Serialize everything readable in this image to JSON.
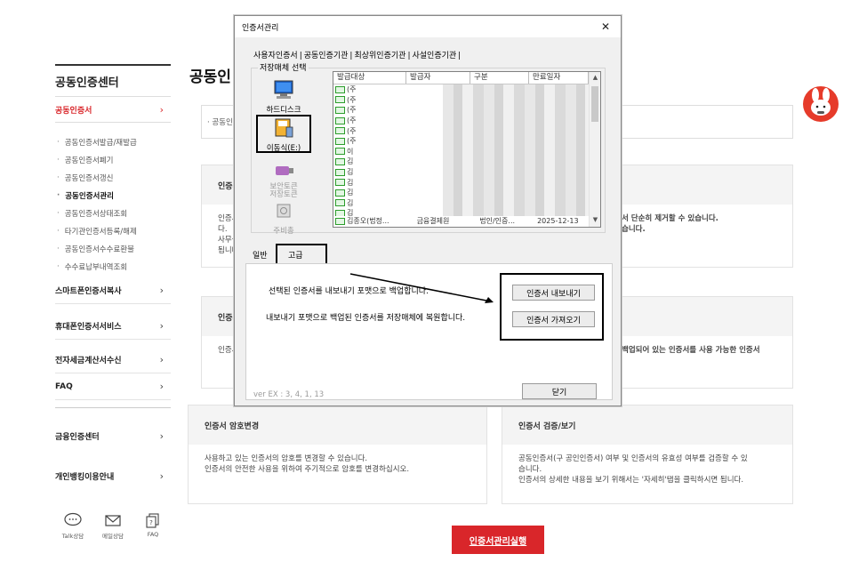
{
  "sidebar": {
    "title": "공동인증센터",
    "main_item": "공동인증서",
    "sub_items": [
      "공동인증서발급/재발급",
      "공동인증서폐기",
      "공동인증서갱신",
      "공동인증서관리",
      "공동인증서상태조회",
      "타기관인증서등록/해제",
      "공동인증서수수료환불",
      "수수료납부내역조회"
    ],
    "active_sub_index": 3,
    "sections": [
      "스마트폰인증서복사",
      "휴대폰인증서서비스",
      "전자세금계산서수신",
      "FAQ"
    ],
    "sections2": [
      "금융인증센터",
      "개인뱅킹이용안내"
    ],
    "footer_icons": [
      {
        "icon": "chat-bubble-icon",
        "label": "Talk상담"
      },
      {
        "icon": "mail-icon",
        "label": "메일상담"
      },
      {
        "icon": "faq-icon",
        "label": "FAQ"
      }
    ]
  },
  "main": {
    "title": "공동인",
    "info_text": "· 공동인",
    "cards": [
      {
        "header": "인증서",
        "body": [
          "인증서",
          "다.",
          "사무실",
          "됩니다"
        ]
      },
      {
        "header": "",
        "body": [
          "서 단순히 제거할 수 있습니다.",
          "습니다."
        ]
      },
      {
        "header": "인증서",
        "body": [
          "인증서"
        ]
      },
      {
        "header": "",
        "body": [
          "백업되어 있는 인증서를 사용 가능한 인증서"
        ]
      },
      {
        "header": "인증서 암호변경",
        "body": [
          "사용하고 있는 인증서의 암호를 변경할 수 있습니다.",
          "인증서의 안전한 사용을 위하여 주기적으로 암호를 변경하십시오."
        ]
      },
      {
        "header": "인증서 검증/보기",
        "body": [
          "공동인증서(구 공인인증서) 여부 및 인증서의 유효성 여부를 검증할 수 있",
          "습니다.",
          "인증서의 상세한 내용을 보기 위해서는 '자세히'탭을 클릭하시면 됩니다."
        ]
      }
    ],
    "run_button": "인증서관리실행"
  },
  "dialog": {
    "title": "인증서관리",
    "tabs": [
      "사용자인증서",
      "공동인증기관",
      "최상위인증기관",
      "사설인증기관"
    ],
    "group_label": "저장매체 선택",
    "media": [
      {
        "label": "하드디스크",
        "icon": "monitor-icon",
        "state": "normal"
      },
      {
        "label": "이동식(E:)",
        "icon": "removable-disk-icon",
        "state": "selected"
      },
      {
        "label": "보안토큰\n저장토큰",
        "icon": "usb-token-icon",
        "state": "disabled"
      },
      {
        "label": "주비총",
        "icon": "chip-icon",
        "state": "disabled"
      }
    ],
    "list_columns": [
      "발급대상",
      "발급자",
      "구분",
      "만료일자"
    ],
    "list_rows": [
      "(주",
      "(주",
      "(주",
      "(주",
      "(주",
      "(주",
      "이",
      "김",
      "김",
      "김",
      "김",
      "김",
      "김",
      "김종오(법정..."
    ],
    "last_row_cells": [
      "김종오(법정...",
      "금융결제원",
      "법인/인증...",
      "2025-12-13"
    ],
    "bottom_tabs": [
      "일반",
      "고급"
    ],
    "export_text": "선택된 인증서를 내보내기 포맷으로 백업합니다.",
    "import_text": "내보내기 포맷으로 백업된 인증서를 저장매체에 복원합니다.",
    "export_button": "인증서 내보내기",
    "import_button": "인증서 가져오기",
    "close_button": "닫기",
    "version": "ver EX : 3, 4, 1, 13"
  }
}
